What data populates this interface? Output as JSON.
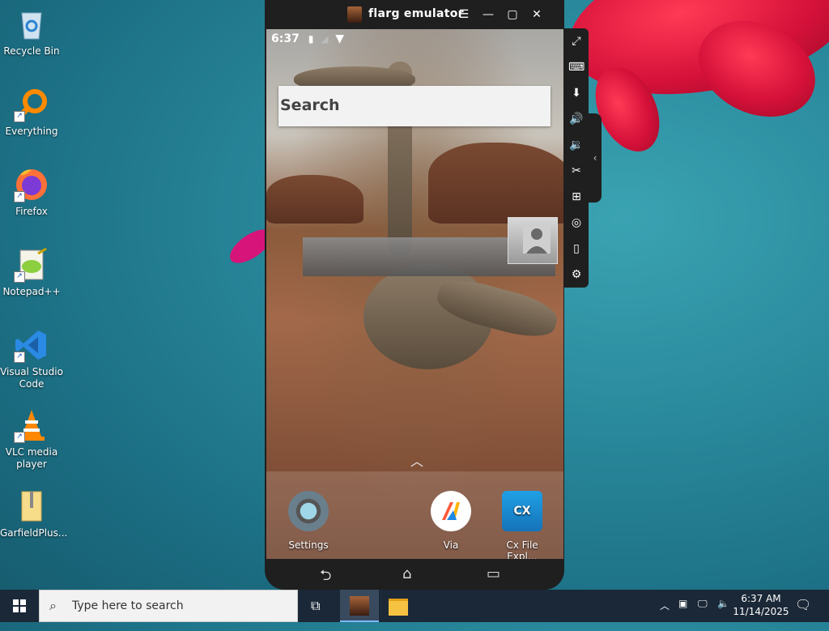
{
  "desktop": {
    "icons": [
      {
        "label": "Recycle Bin"
      },
      {
        "label": "Everything"
      },
      {
        "label": "Firefox"
      },
      {
        "label": "Notepad++"
      },
      {
        "label": "Visual Studio Code"
      },
      {
        "label": "VLC media player"
      },
      {
        "label": "GarfieldPlus..."
      }
    ]
  },
  "emulator": {
    "title": "flarg emulator",
    "status_time": "6:37",
    "search_label": "Search",
    "dock_apps": [
      {
        "label": "Settings",
        "icon": "settings-icon"
      },
      {
        "label": "Via",
        "icon": "via-browser-icon"
      },
      {
        "label": "Cx File Expl…",
        "icon": "cx-file-explorer-icon"
      }
    ],
    "toolbar_icons": [
      "fullscreen-icon",
      "keyboard-icon",
      "apk-install-icon",
      "volume-up-icon",
      "volume-down-icon",
      "screenshot-icon",
      "multi-instance-icon",
      "location-icon",
      "shake-icon",
      "settings-icon"
    ]
  },
  "taskbar": {
    "search_placeholder": "Type here to search",
    "time": "6:37 AM",
    "date": "11/14/2025"
  },
  "colors": {
    "desktop_bg": "#2a8a9d",
    "taskbar_bg": "#1b2838",
    "emulator_frame": "#1f1f1f"
  }
}
